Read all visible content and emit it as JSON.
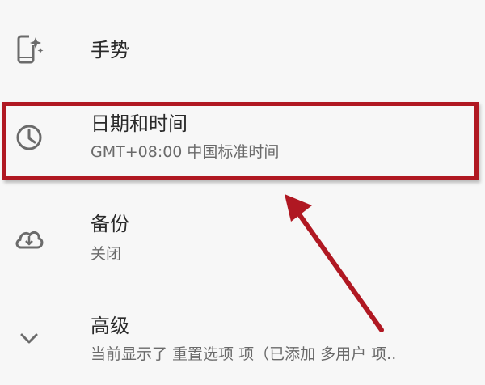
{
  "settings": {
    "items": [
      {
        "title": "手势",
        "subtitle": "",
        "icon": "gesture-phone-icon"
      },
      {
        "title": "日期和时间",
        "subtitle": "GMT+08:00 中国标准时间",
        "icon": "clock-icon"
      },
      {
        "title": "备份",
        "subtitle": "关闭",
        "icon": "cloud-backup-icon"
      },
      {
        "title": "高级",
        "subtitle": "当前显示了 重置选项 项（已添加 多用户 项..",
        "icon": "chevron-down-icon"
      }
    ]
  },
  "annotation": {
    "color": "#b01822"
  }
}
